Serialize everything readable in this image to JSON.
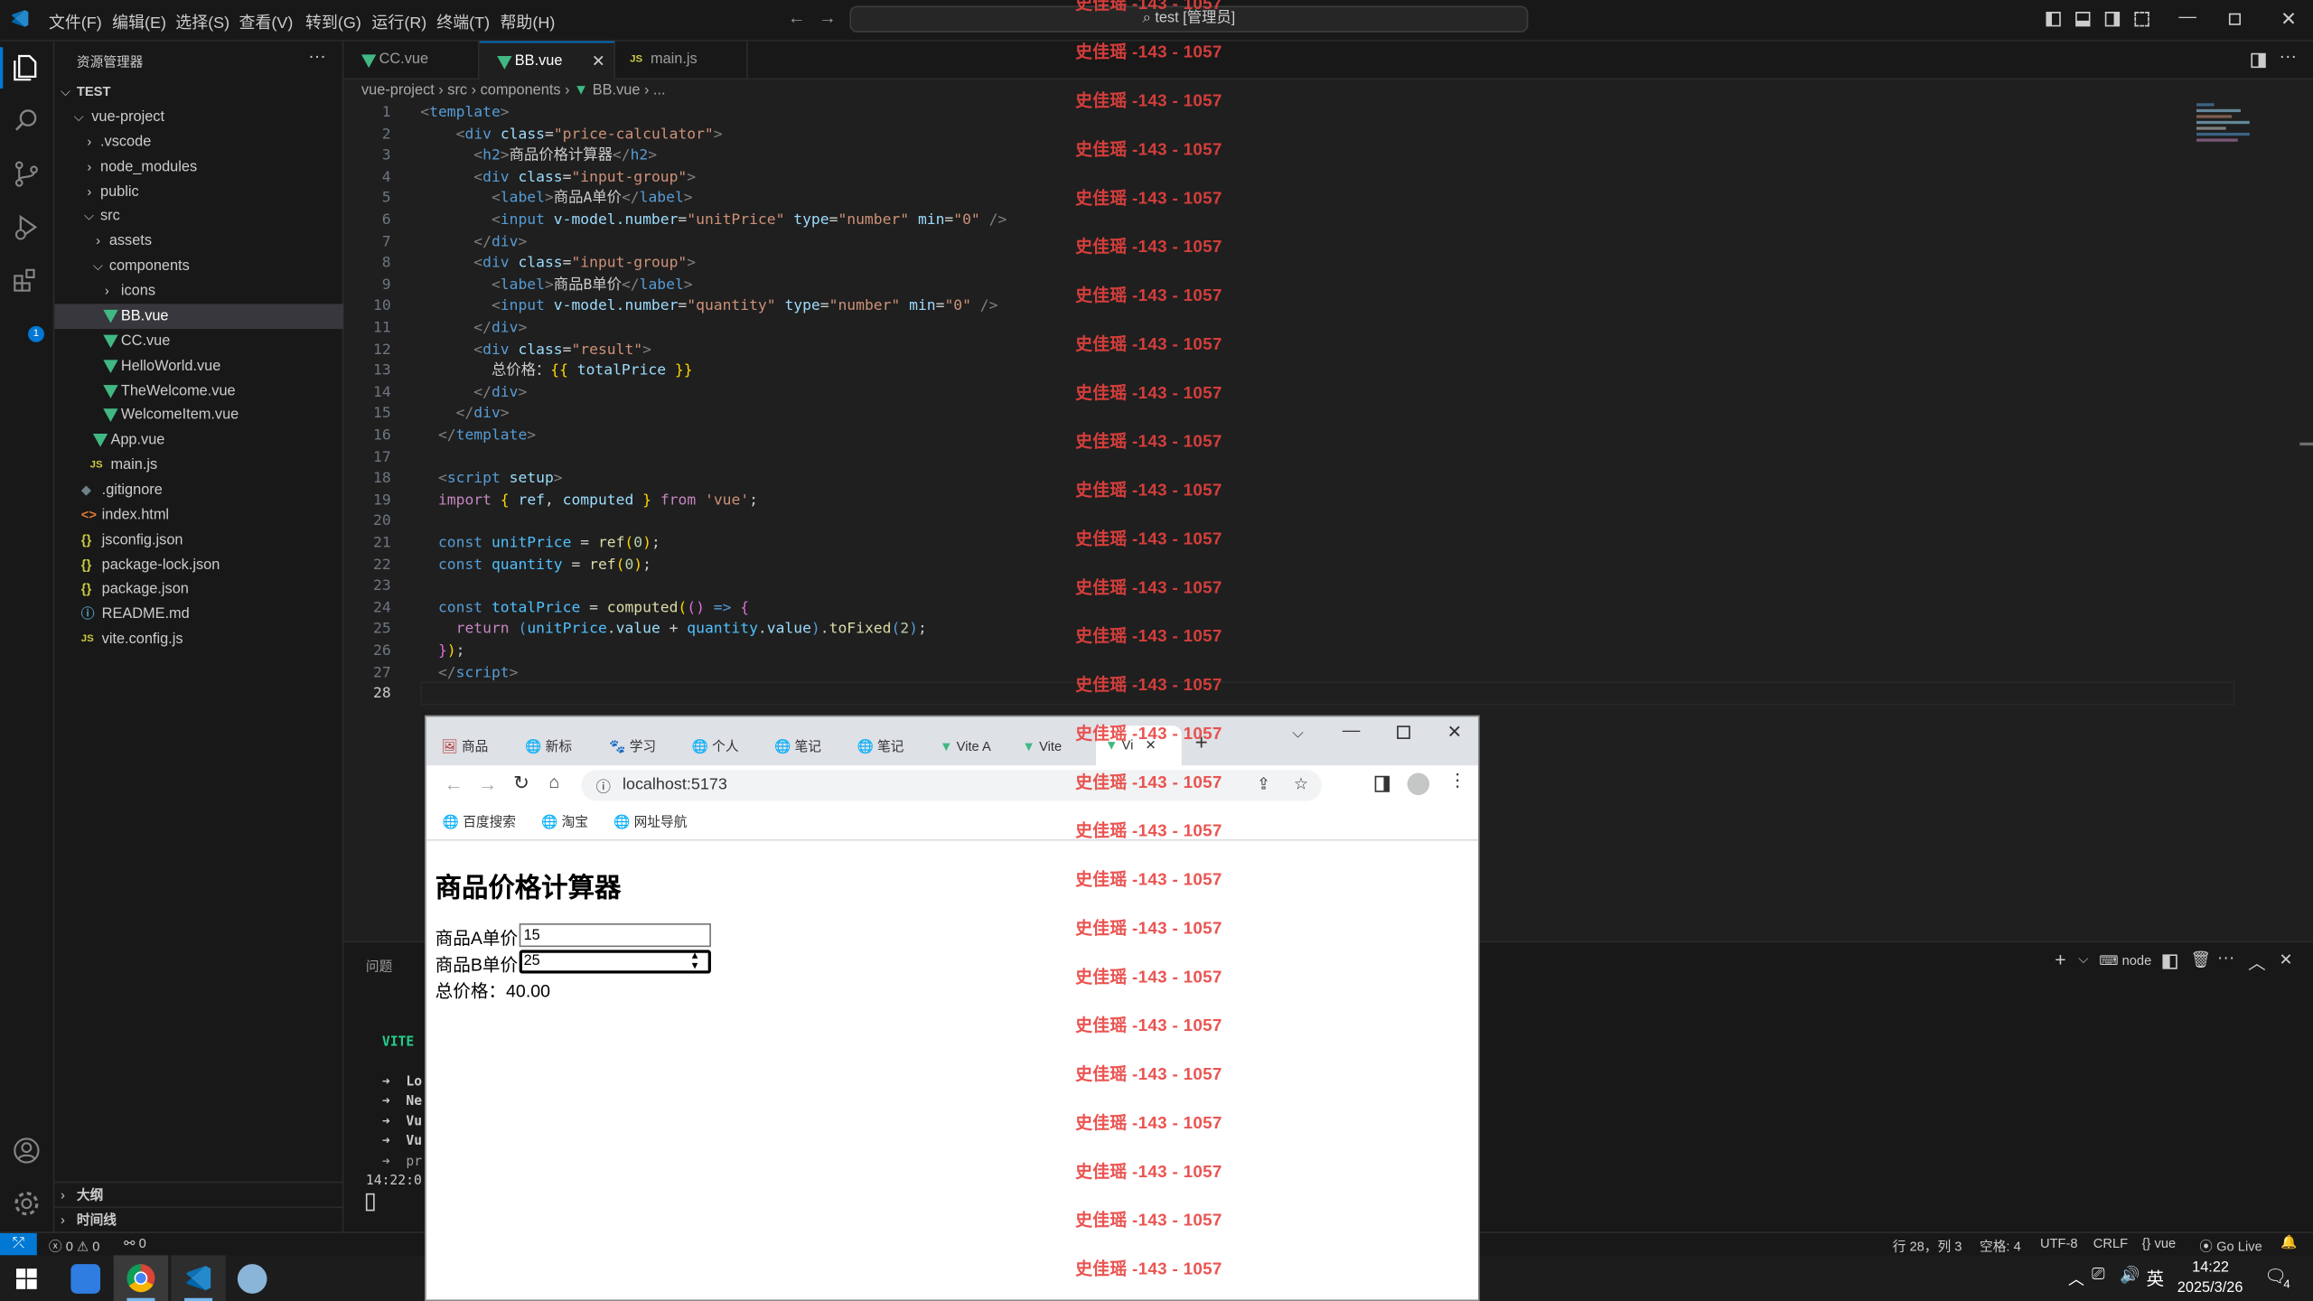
{
  "titlebar": {
    "menus": [
      "文件(F)",
      "编辑(E)",
      "选择(S)",
      "查看(V)",
      "转到(G)",
      "运行(R)",
      "终端(T)",
      "帮助(H)"
    ],
    "search_text": "test [管理员]"
  },
  "sidebar": {
    "header": "资源管理器",
    "root": "TEST",
    "items": [
      {
        "label": "vue-project"
      },
      {
        "label": ".vscode"
      },
      {
        "label": "node_modules"
      },
      {
        "label": "public"
      },
      {
        "label": "src"
      },
      {
        "label": "assets"
      },
      {
        "label": "components"
      },
      {
        "label": "icons"
      },
      {
        "label": "BB.vue"
      },
      {
        "label": "CC.vue"
      },
      {
        "label": "HelloWorld.vue"
      },
      {
        "label": "TheWelcome.vue"
      },
      {
        "label": "WelcomeItem.vue"
      },
      {
        "label": "App.vue"
      },
      {
        "label": "main.js"
      },
      {
        "label": ".gitignore"
      },
      {
        "label": "index.html"
      },
      {
        "label": "jsconfig.json"
      },
      {
        "label": "package-lock.json"
      },
      {
        "label": "package.json"
      },
      {
        "label": "README.md"
      },
      {
        "label": "vite.config.js"
      }
    ],
    "outline": "大纲",
    "timeline": "时间线",
    "extensions_badge": "1"
  },
  "tabs": [
    {
      "label": "CC.vue"
    },
    {
      "label": "BB.vue"
    },
    {
      "label": "main.js"
    }
  ],
  "breadcrumb": [
    "vue-project",
    "src",
    "components",
    "BB.vue",
    "..."
  ],
  "code_line_numbers": [
    "1",
    "2",
    "3",
    "4",
    "5",
    "6",
    "7",
    "8",
    "9",
    "10",
    "11",
    "12",
    "13",
    "14",
    "15",
    "16",
    "17",
    "18",
    "19",
    "20",
    "21",
    "22",
    "23",
    "24",
    "25",
    "26",
    "27",
    "28"
  ],
  "panel": {
    "tab_problems": "问题",
    "terminal_name": "node",
    "lines": [
      "VITE",
      "➜  Lo",
      "➜  Ne",
      "➜  Vu",
      "➜  Vu",
      "➜  pr",
      "14:22:0"
    ]
  },
  "status": {
    "errors": "0",
    "warnings": "0",
    "ports": "0",
    "position": "行 28，列 3",
    "spaces": "空格: 4",
    "encoding": "UTF-8",
    "eol": "CRLF",
    "language": "vue",
    "golive": "Go Live"
  },
  "browser": {
    "tabs": [
      "商品",
      "新标",
      "学习",
      "个人",
      "笔记",
      "笔记",
      "Vite A",
      "Vite",
      "Vi"
    ],
    "url": "localhost:5173",
    "bookmarks": [
      "百度搜索",
      "淘宝",
      "网址导航"
    ],
    "page": {
      "heading": "商品价格计算器",
      "label_a": "商品A单价",
      "value_a": "15",
      "label_b": "商品B单价",
      "value_b": "25",
      "total_label": "总价格：",
      "total_value": "40.00"
    }
  },
  "watermark": "史佳瑶 -143 - 1057",
  "taskbar": {
    "time": "14:22",
    "date": "2025/3/26",
    "ime": "英",
    "notifications": "4"
  },
  "colors": {
    "accent": "#0078d4",
    "vue_green": "#41b883",
    "watermark": "#e8423f"
  }
}
